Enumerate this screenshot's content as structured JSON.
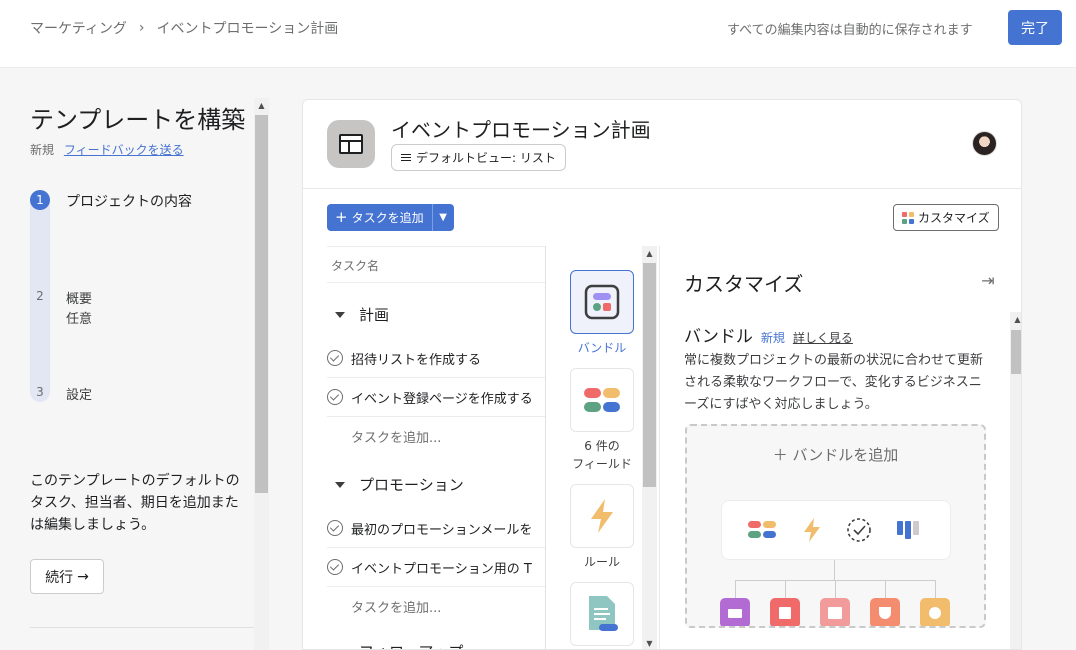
{
  "breadcrumb": {
    "parent": "マーケティング",
    "separator": "›",
    "current": "イベントプロモーション計画"
  },
  "header": {
    "autosave_text": "すべての編集内容は自動的に保存されます",
    "done_label": "完了",
    "accent": "#4573d2"
  },
  "left": {
    "title": "テンプレートを構築",
    "new_label": "新規",
    "feedback_link": "フィードバックを送る",
    "steps": [
      {
        "number": "1",
        "label": "プロジェクトの内容",
        "sub": ""
      },
      {
        "number": "2",
        "label": "概要",
        "sub": "任意"
      },
      {
        "number": "3",
        "label": "設定",
        "sub": ""
      }
    ],
    "description": "このテンプレートのデフォルトのタスク、担当者、期日を追加または編集しましょう。",
    "continue_label": "続行",
    "continue_arrow": "→"
  },
  "project": {
    "title": "イベントプロモーション計画",
    "view_chip": "デフォルトビュー: リスト",
    "add_task_label": "タスクを追加",
    "customize_label": "カスタマイズ"
  },
  "tasks": {
    "column_header": "タスク名",
    "sections": [
      {
        "name": "計画",
        "tasks": [
          "招待リストを作成する",
          "イベント登録ページを作成する"
        ],
        "add_label": "タスクを追加..."
      },
      {
        "name": "プロモーション",
        "tasks": [
          "最初のプロモーションメールを",
          "イベントプロモーション用の T"
        ],
        "add_label": "タスクを追加..."
      },
      {
        "name": "フォローアップ",
        "tasks": [],
        "add_label": ""
      }
    ]
  },
  "customize": {
    "title": "カスタマイズ",
    "rail": [
      {
        "label": "バンドル",
        "icon": "bundle-icon"
      },
      {
        "label": "6 件の\nフィールド",
        "icon": "fields-icon"
      },
      {
        "label": "ルール",
        "icon": "lightning-icon"
      },
      {
        "label": "",
        "icon": "form-icon"
      }
    ],
    "bundle": {
      "heading": "バンドル",
      "new_label": "新規",
      "learn_more": "詳しく見る",
      "description": "常に複数プロジェクトの最新の状況に合わせて更新される柔軟なワークフローで、変化するビジネスニーズにすばやく対応しましょう。",
      "add_label": "バンドルを追加"
    }
  }
}
